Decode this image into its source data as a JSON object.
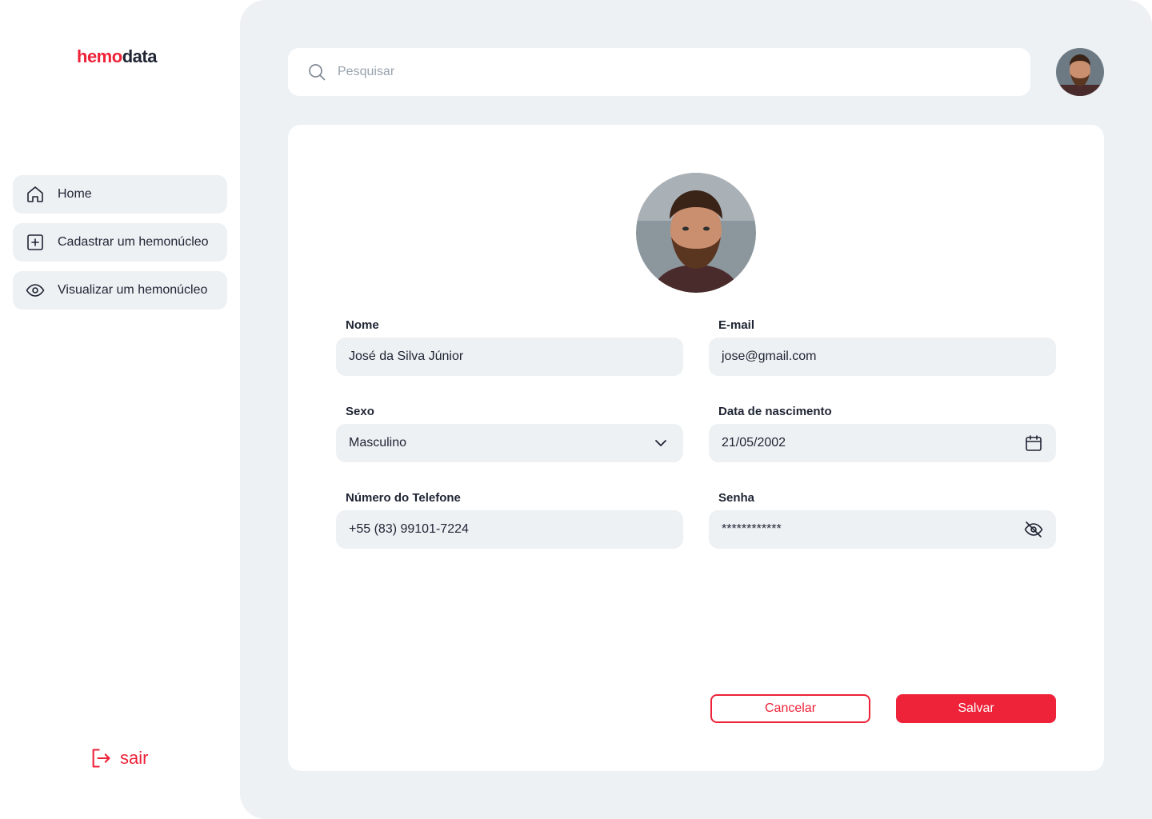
{
  "brand": {
    "logo_part1": "hemo",
    "logo_part2": "data",
    "accent_color": "#ee2238",
    "text_color": "#1f2433"
  },
  "sidebar": {
    "items": [
      {
        "label": "Home",
        "icon": "home-icon"
      },
      {
        "label": "Cadastrar um hemonúcleo",
        "icon": "plus-square-icon"
      },
      {
        "label": "Visualizar um hemonúcleo",
        "icon": "eye-icon"
      }
    ],
    "logout": {
      "label": "sair",
      "icon": "logout-icon"
    }
  },
  "header": {
    "search": {
      "placeholder": "Pesquisar",
      "icon": "search-icon"
    },
    "avatar": "user-avatar"
  },
  "profile_form": {
    "avatar": "profile-photo",
    "fields": {
      "nome": {
        "label": "Nome",
        "value": "José da Silva Júnior"
      },
      "email": {
        "label": "E-mail",
        "value": "jose@gmail.com"
      },
      "sexo": {
        "label": "Sexo",
        "value": "Masculino",
        "icon": "chevron-down-icon"
      },
      "data_nascimento": {
        "label": "Data de nascimento",
        "value": "21/05/2002",
        "icon": "calendar-icon"
      },
      "telefone": {
        "label": "Número do Telefone",
        "value": "+55 (83) 99101-7224"
      },
      "senha": {
        "label": "Senha",
        "value": "************",
        "icon": "eye-off-icon"
      }
    },
    "buttons": {
      "cancel": "Cancelar",
      "save": "Salvar"
    }
  }
}
